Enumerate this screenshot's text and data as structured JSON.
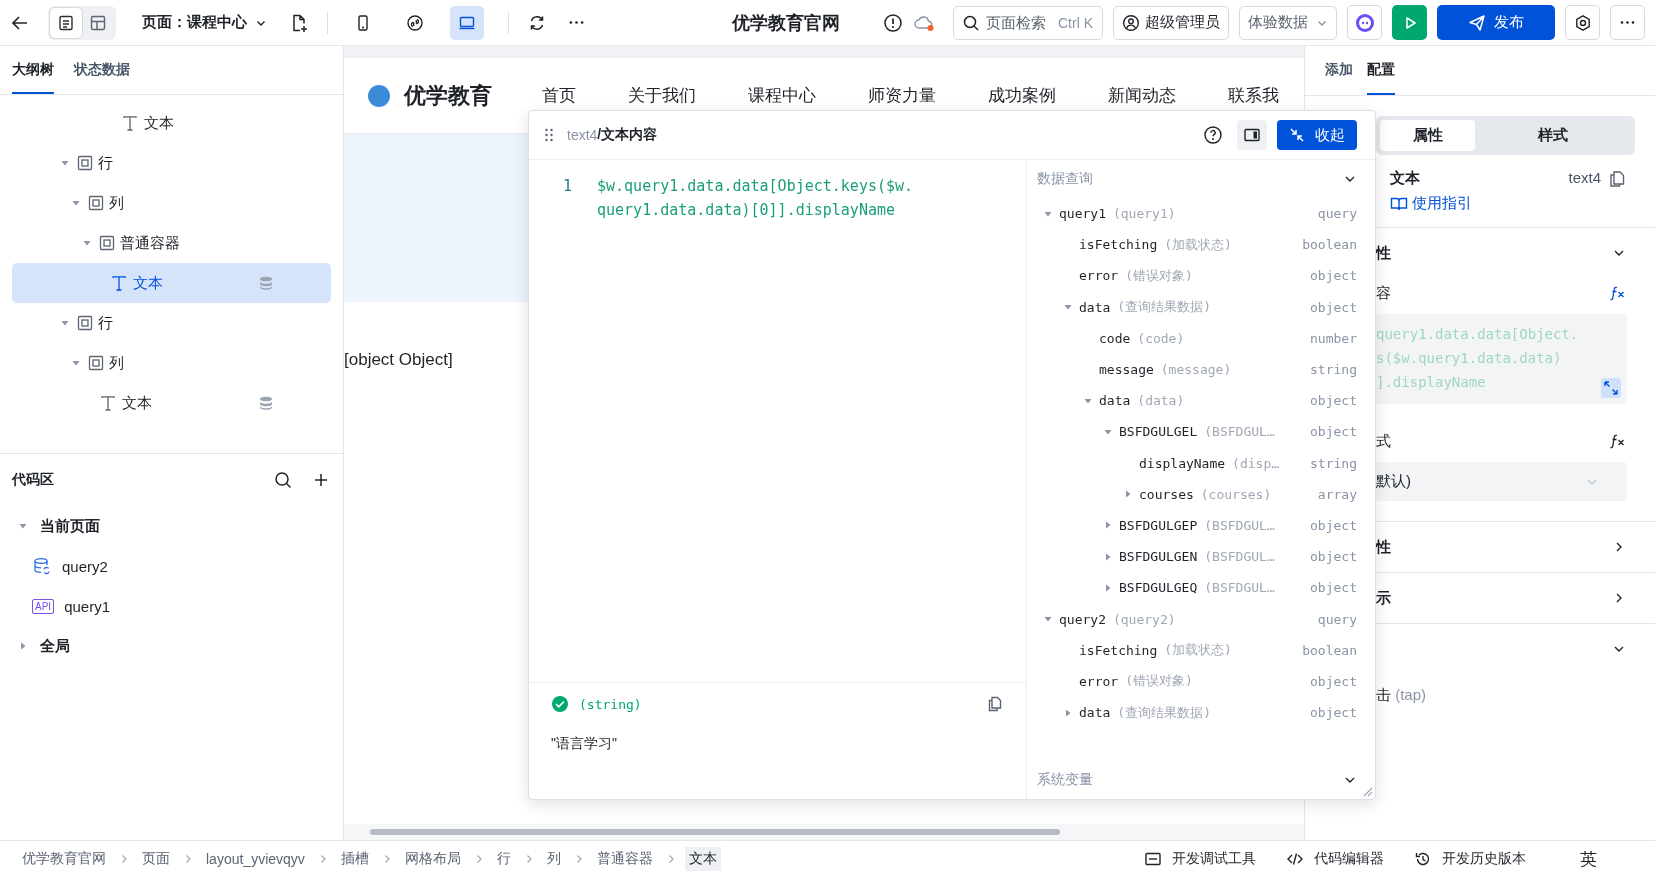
{
  "topbar": {
    "view_toggle": [
      {
        "kind": "outline",
        "selected": true
      },
      {
        "kind": "layout",
        "selected": false
      }
    ],
    "page_selector": "页面：课程中心",
    "devices": [
      {
        "kind": "mobile",
        "selected": false
      },
      {
        "kind": "miniprogram",
        "selected": false
      },
      {
        "kind": "desktop",
        "selected": true
      }
    ],
    "app_title": "优学教育官网",
    "search": {
      "placeholder": "页面检索",
      "shortcut": "Ctrl K"
    },
    "user": "超级管理员",
    "data_mode": "体验数据",
    "publish": "发布"
  },
  "left": {
    "tabs": [
      {
        "label": "大纲树",
        "selected": true
      },
      {
        "label": "状态数据",
        "selected": false
      }
    ],
    "outline": {
      "top_item": {
        "label": "文本",
        "kind": "text",
        "selected": false,
        "bound": false
      },
      "items": [
        {
          "label": "行",
          "kind": "container",
          "expanded": true,
          "selected": false,
          "bound": false,
          "children": [
            {
              "label": "列",
              "kind": "container",
              "expanded": true,
              "selected": false,
              "bound": false,
              "children": [
                {
                  "label": "普通容器",
                  "kind": "container",
                  "expanded": true,
                  "selected": false,
                  "bound": false,
                  "children": [
                    {
                      "label": "文本",
                      "kind": "text",
                      "selected": true,
                      "bound": true
                    }
                  ]
                }
              ]
            }
          ]
        },
        {
          "label": "行",
          "kind": "container",
          "expanded": true,
          "selected": false,
          "bound": false,
          "children": [
            {
              "label": "列",
              "kind": "container",
              "expanded": true,
              "selected": false,
              "bound": false,
              "children": [
                {
                  "label": "文本",
                  "kind": "text",
                  "selected": false,
                  "bound": true
                }
              ]
            }
          ]
        }
      ]
    },
    "code_area": {
      "title": "代码区",
      "groups": [
        {
          "label": "当前页面",
          "expanded": true,
          "children": [
            {
              "label": "query2",
              "kind": "database"
            },
            {
              "label": "query1",
              "kind": "api",
              "badge": "API"
            }
          ]
        },
        {
          "label": "全局",
          "expanded": false
        }
      ]
    }
  },
  "canvas": {
    "brand": "优学教育",
    "nav": [
      "首页",
      "关于我们",
      "课程中心",
      "师资力量",
      "成功案例",
      "新闻动态",
      "联系我"
    ],
    "body_text": "[object Object]"
  },
  "popup": {
    "path": "text4",
    "title": "/文本内容",
    "collapse": "收起",
    "line_number": "1",
    "code": "$w.query1.data.data[Object.keys($w.query1.data.data)[0]].displayName",
    "result_type": "(string)",
    "result_value": "\"语言学习\"",
    "sections": [
      {
        "title": "数据查询",
        "expanded": true,
        "tree": [
          {
            "name": "query1",
            "hint": "(query1)",
            "type": "query",
            "expanded": true,
            "children": [
              {
                "name": "isFetching",
                "hint": "(加载状态)",
                "type": "boolean"
              },
              {
                "name": "error",
                "hint": "(错误对象)",
                "type": "object"
              },
              {
                "name": "data",
                "hint": "(查询结果数据)",
                "type": "object",
                "expanded": true,
                "children": [
                  {
                    "name": "code",
                    "hint": "(code)",
                    "type": "number"
                  },
                  {
                    "name": "message",
                    "hint": "(message)",
                    "type": "string"
                  },
                  {
                    "name": "data",
                    "hint": "(data)",
                    "type": "object",
                    "expanded": true,
                    "children": [
                      {
                        "name": "BSFDGULGEL",
                        "hint": "(BSFDGUL…",
                        "type": "object",
                        "expanded": true,
                        "children": [
                          {
                            "name": "displayName",
                            "hint": "(disp…",
                            "type": "string"
                          },
                          {
                            "name": "courses",
                            "hint": "(courses)",
                            "type": "array",
                            "expanded": false
                          }
                        ]
                      },
                      {
                        "name": "BSFDGULGEP",
                        "hint": "(BSFDGUL…",
                        "type": "object",
                        "expanded": false
                      },
                      {
                        "name": "BSFDGULGEN",
                        "hint": "(BSFDGUL…",
                        "type": "object",
                        "expanded": false
                      },
                      {
                        "name": "BSFDGULGEQ",
                        "hint": "(BSFDGUL…",
                        "type": "object",
                        "expanded": false
                      }
                    ]
                  }
                ]
              }
            ]
          },
          {
            "name": "query2",
            "hint": "(query2)",
            "type": "query",
            "expanded": true,
            "children": [
              {
                "name": "isFetching",
                "hint": "(加载状态)",
                "type": "boolean"
              },
              {
                "name": "error",
                "hint": "(错误对象)",
                "type": "object"
              },
              {
                "name": "data",
                "hint": "(查询结果数据)",
                "type": "object",
                "expanded": false
              }
            ]
          }
        ]
      },
      {
        "title": "系统变量",
        "expanded": true
      }
    ]
  },
  "right": {
    "tabs": [
      {
        "label": "添加",
        "selected": false
      },
      {
        "label": "配置",
        "selected": true
      }
    ],
    "segments": [
      {
        "label": "属性",
        "selected": true
      },
      {
        "label": "样式",
        "selected": false
      }
    ],
    "component": {
      "name": "文本",
      "id": "text4",
      "guide": "使用指引"
    },
    "sections": [
      {
        "title": "性",
        "expanded": true,
        "fields": [
          {
            "label": "容",
            "kind": "code",
            "lines": [
              "query1.data.data[Object.",
              "s($w.query1.data.data)",
              "].displayName"
            ]
          },
          {
            "label": "式",
            "kind": "select",
            "value": "默认)"
          }
        ]
      },
      {
        "title": "性",
        "expanded": false
      },
      {
        "title": "示",
        "expanded": false
      },
      {
        "expanded": true,
        "events": [
          {
            "label": "击",
            "hint": "(tap)"
          }
        ]
      }
    ]
  },
  "bottom": {
    "breadcrumb": [
      {
        "label": "优学教育官网",
        "selected": false
      },
      {
        "label": "页面",
        "selected": false
      },
      {
        "label": "layout_yvievqyv",
        "selected": false
      },
      {
        "label": "插槽",
        "selected": false
      },
      {
        "label": "网格布局",
        "selected": false
      },
      {
        "label": "行",
        "selected": false
      },
      {
        "label": "列",
        "selected": false
      },
      {
        "label": "普通容器",
        "selected": false
      },
      {
        "label": "文本",
        "selected": true
      }
    ],
    "tools": [
      {
        "kind": "debug",
        "label": "开发调试工具"
      },
      {
        "kind": "code",
        "label": "代码编辑器"
      },
      {
        "kind": "history",
        "label": "开发历史版本"
      }
    ],
    "ime": "英"
  }
}
